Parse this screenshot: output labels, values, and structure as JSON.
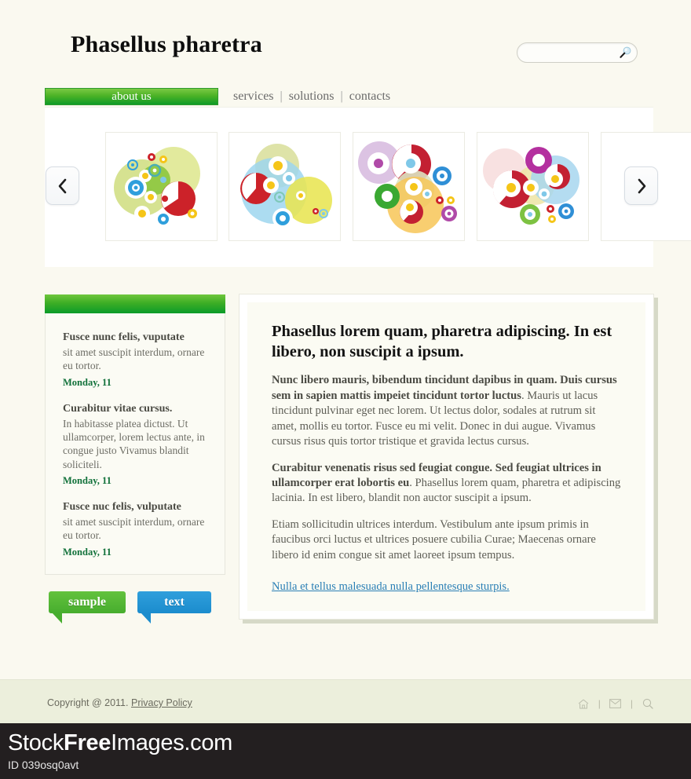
{
  "header": {
    "title": "Phasellus pharetra",
    "search": {
      "value": "",
      "placeholder": "",
      "icon": "search-icon"
    }
  },
  "nav": {
    "active": "about us",
    "links": [
      "services",
      "solutions",
      "contacts"
    ],
    "separator": "|",
    "active_bg": "#3eae25"
  },
  "carousel": {
    "prev_icon": "chevron-left-icon",
    "next_icon": "chevron-right-icon",
    "slides": [
      {
        "name": "slide-1",
        "alt": "green and red gear flowers illustration"
      },
      {
        "name": "slide-2",
        "alt": "blue and yellow gear flowers illustration"
      },
      {
        "name": "slide-3",
        "alt": "purple red and orange gear flowers illustration"
      },
      {
        "name": "slide-4",
        "alt": "pink magenta and blue gear flowers illustration"
      },
      {
        "name": "slide-5",
        "alt": "partially visible next illustration"
      }
    ]
  },
  "sidebar": {
    "news": [
      {
        "title": "Fusce nunc felis, vuputate",
        "text": "sit amet suscipit interdum, ornare eu tortor.",
        "date": "Monday, 11"
      },
      {
        "title": "Curabitur vitae cursus.",
        "text": "In habitasse platea dictust. Ut ullamcorper, lorem lectus ante, in congue justo Vivamus blandit soliciteli.",
        "date": "Monday, 11"
      },
      {
        "title": "Fusce nuc felis, vulputate",
        "text": "sit amet suscipit interdum, ornare eu tortor.",
        "date": "Monday, 11"
      }
    ]
  },
  "tags": [
    {
      "label": "sample",
      "color": "#47ad2e"
    },
    {
      "label": "text",
      "color": "#1b8ccd"
    }
  ],
  "main": {
    "heading": "Phasellus lorem quam, pharetra adipiscing. In est libero, non suscipit a ipsum.",
    "paragraphs": [
      {
        "bold": "Nunc libero mauris, bibendum  tincidunt dapibus in quam. Duis cursus sem in sapien mattis impeiet tincidunt tortor luctus",
        "rest": ". Mauris ut lacus tincidunt pulvinar eget nec lorem. Ut lectus dolor, sodales at rutrum sit amet, mollis eu tortor. Fusce eu mi velit. Donec in dui augue. Vivamus cursus risus quis tortor tristique et gravida lectus cursus."
      },
      {
        "bold": "Curabitur venenatis risus sed feugiat congue. Sed feugiat ultrices in ullamcorper erat lobortis eu",
        "rest": ". Phasellus lorem quam, pharetra et adipiscing lacinia. In est libero, blandit non auctor suscipit a ipsum."
      },
      {
        "bold": "",
        "rest": "Etiam sollicitudin ultrices interdum. Vestibulum ante ipsum primis in faucibus orci luctus et ultrices posuere cubilia Curae; Maecenas ornare libero id enim congue sit amet laoreet ipsum tempus."
      }
    ],
    "link": "Nulla et tellus malesuada nulla pellentesque sturpis.",
    "link_color": "#2a7fb5"
  },
  "footer": {
    "copyright": "Copyright @ 2011.",
    "privacy_label": "Privacy Policy",
    "separator": "|",
    "icons": [
      "home-icon",
      "mail-icon",
      "search-icon"
    ]
  },
  "watermark": {
    "brand_prefix": "Stock",
    "brand_bold": "Free",
    "brand_suffix": "Images.com",
    "id": "ID 039osq0avt"
  }
}
